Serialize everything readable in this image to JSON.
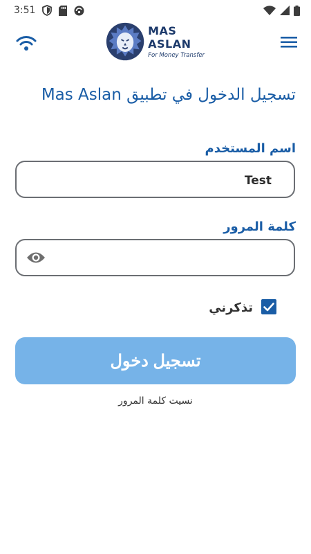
{
  "status_bar": {
    "time": "3:51"
  },
  "header": {
    "logo": {
      "name": "MAS ASLAN",
      "tagline": "For Money Transfer"
    },
    "icons": {
      "left": "wifi-icon",
      "right": "menu-icon"
    }
  },
  "login": {
    "title": "تسجيل الدخول في تطبيق Mas Aslan",
    "username_label": "اسم المستخدم",
    "username_value": "Test",
    "password_label": "كلمة المرور",
    "password_value": "",
    "remember_label": "تذكرني",
    "remember_checked": true,
    "submit_label": "تسجيل دخول",
    "forgot_password": "نسيت كلمة المرور"
  },
  "colors": {
    "primary": "#1a5da6",
    "button": "#76b3e8",
    "border": "#6b6e73"
  }
}
